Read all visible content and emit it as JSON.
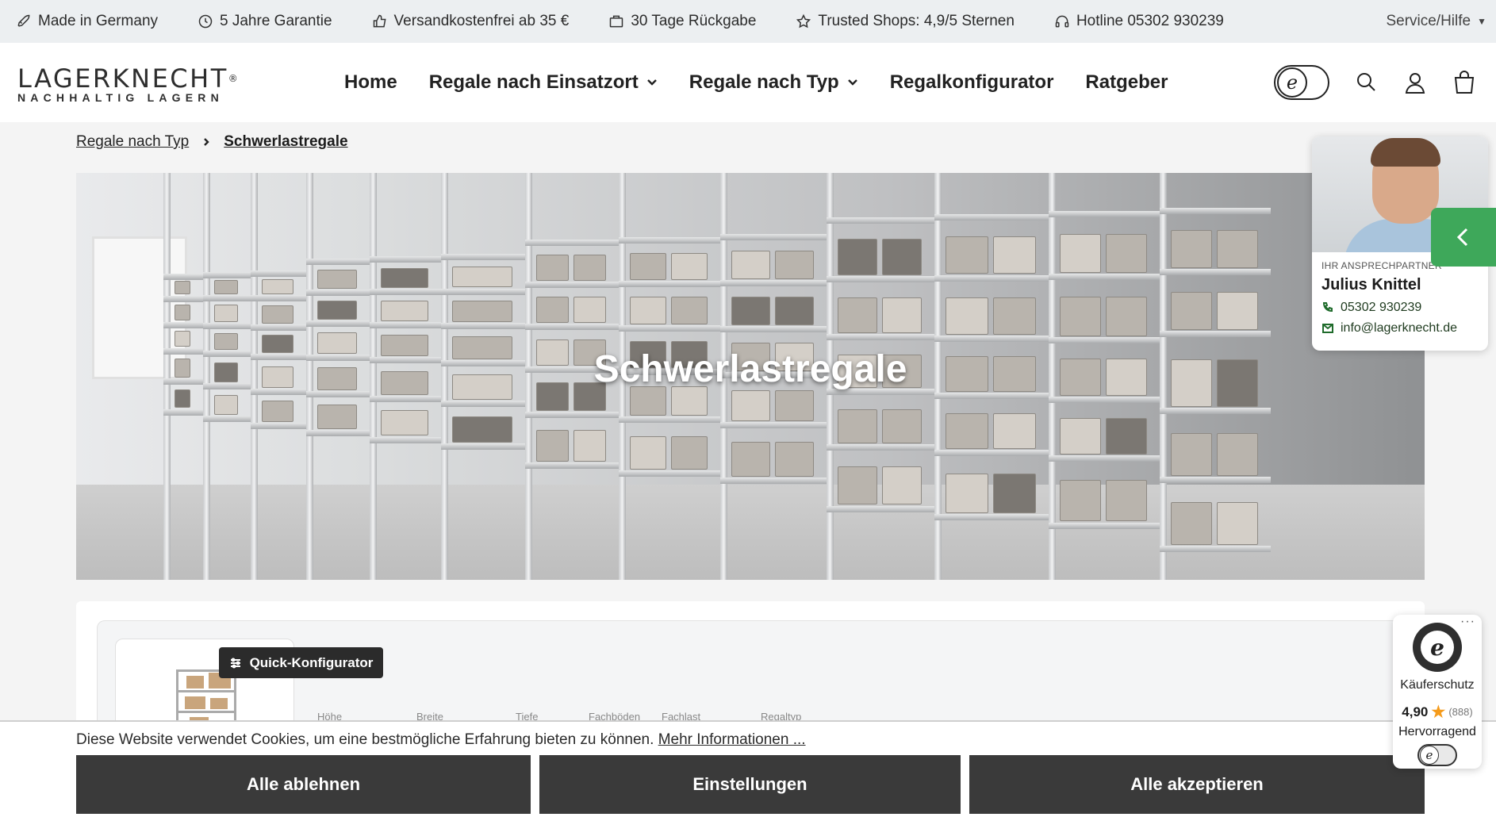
{
  "topbar": {
    "usps": [
      {
        "icon": "rocket-icon",
        "label": "Made in Germany"
      },
      {
        "icon": "clock-icon",
        "label": "5 Jahre Garantie"
      },
      {
        "icon": "thumbs-up-icon",
        "label": "Versandkostenfrei ab 35 €"
      },
      {
        "icon": "box-icon",
        "label": "30 Tage Rückgabe"
      },
      {
        "icon": "star-icon",
        "label": "Trusted Shops: 4,9/5 Sternen"
      },
      {
        "icon": "headset-icon",
        "label": "Hotline 05302 930239"
      }
    ],
    "service_label": "Service/Hilfe"
  },
  "header": {
    "logo_main": "LAGERKNECHT",
    "logo_reg": "®",
    "logo_sub": "NACHHALTIG LAGERN",
    "nav": [
      {
        "label": "Home",
        "has_dropdown": false
      },
      {
        "label": "Regale nach Einsatzort",
        "has_dropdown": true
      },
      {
        "label": "Regale nach Typ",
        "has_dropdown": true
      },
      {
        "label": "Regalkonfigurator",
        "has_dropdown": false
      },
      {
        "label": "Ratgeber",
        "has_dropdown": false
      }
    ],
    "ekomi_letter": "e"
  },
  "breadcrumb": {
    "parent": "Regale nach Typ",
    "current": "Schwerlastregale"
  },
  "hero": {
    "title": "Schwerlastregale"
  },
  "contact": {
    "role": "IHR ANSPRECHPARTNER",
    "name": "Julius Knittel",
    "phone": "05302 930239",
    "email": "info@lagerknecht.de"
  },
  "product": {
    "quick_config_label": "Quick-Konfigurator",
    "field_labels": [
      "Höhe",
      "Breite",
      "Tiefe",
      "Fachböden",
      "Fachlast",
      "Regaltyp"
    ]
  },
  "cookie": {
    "text": "Diese Website verwendet Cookies, um eine bestmögliche Erfahrung bieten zu können.",
    "more_link": "Mehr Informationen ...",
    "reject": "Alle ablehnen",
    "settings": "Einstellungen",
    "accept": "Alle akzeptieren"
  },
  "trusted_shops": {
    "seal_letter": "e",
    "label": "Käuferschutz",
    "score": "4,90",
    "count": "(888)",
    "verdict": "Hervorragend",
    "more": "···"
  },
  "colors": {
    "accent_green": "#3ea85a",
    "button_dark": "#3a3a3a",
    "topbar_bg": "#eceff1"
  }
}
